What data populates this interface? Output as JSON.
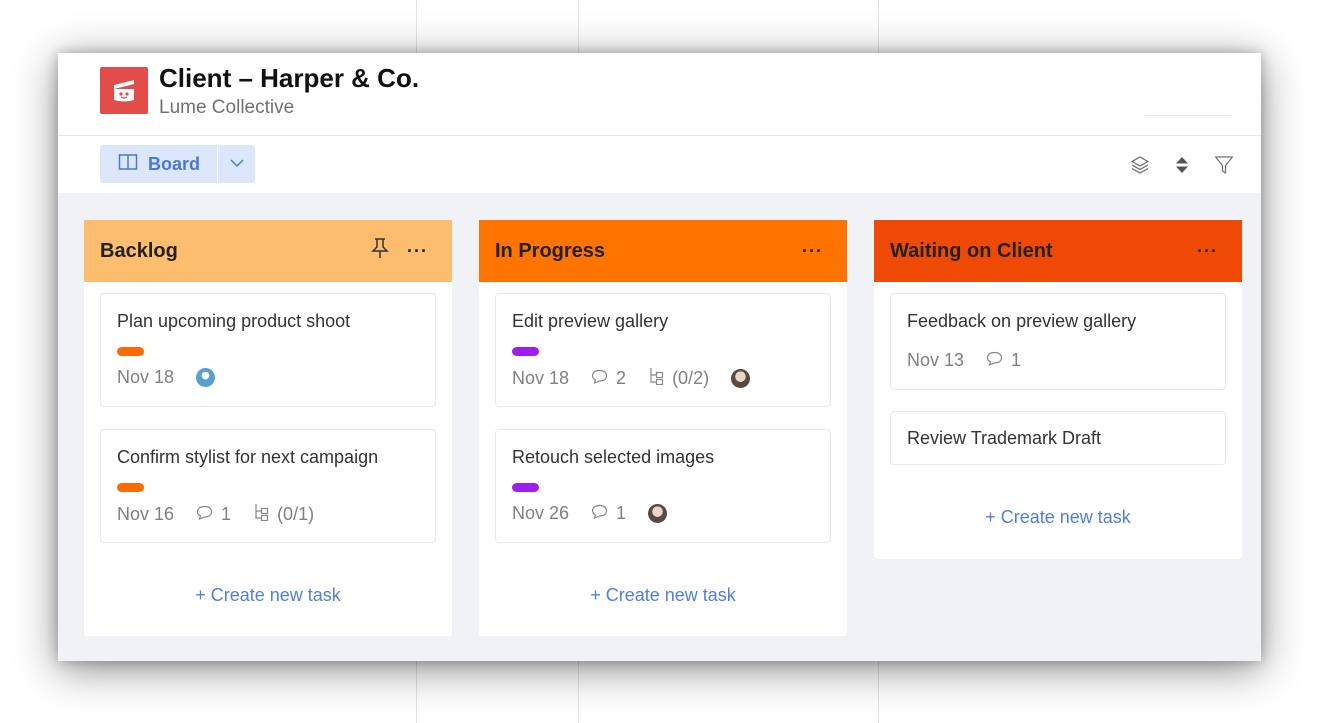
{
  "project": {
    "title": "Client – Harper & Co.",
    "subtitle": "Lume Collective"
  },
  "toolbar": {
    "view_label": "Board",
    "view_icon": "book-open-icon",
    "dropdown_icon": "chevron-down-icon",
    "right_icons": [
      "layers-icon",
      "sort-icon",
      "filter-icon"
    ]
  },
  "colors": {
    "backlog": "#fdbd6e",
    "in_progress": "#ff7300",
    "waiting_on_client": "#ee4a06",
    "tag_orange": "#ff6a00",
    "tag_purple": "#9d1ff0",
    "link": "#4f7fe0",
    "logo": "#e24c4b"
  },
  "columns": [
    {
      "name": "Backlog",
      "create_label": "+ Create new task",
      "cards": [
        {
          "title": "Plan upcoming product shoot",
          "date": "Nov 18"
        },
        {
          "title": "Confirm stylist for next campaign",
          "date": "Nov 16",
          "comments": "1",
          "subtasks": "(0/1)"
        }
      ]
    },
    {
      "name": "In Progress",
      "create_label": "+ Create new task",
      "cards": [
        {
          "title": "Edit preview gallery",
          "date": "Nov 18",
          "comments": "2",
          "subtasks": "(0/2)"
        },
        {
          "title": "Retouch selected images",
          "date": "Nov 26",
          "comments": "1"
        }
      ]
    },
    {
      "name": "Waiting on Client",
      "create_label": "+ Create new task",
      "cards": [
        {
          "title": "Feedback on preview gallery",
          "date": "Nov 13",
          "comments": "1"
        },
        {
          "title": "Review Trademark Draft"
        }
      ]
    }
  ]
}
